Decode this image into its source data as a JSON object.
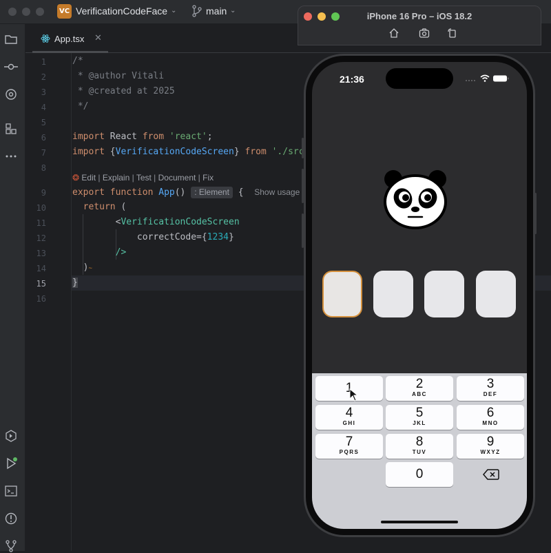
{
  "ide": {
    "project_badge": "VC",
    "project_name": "VerificationCodeFace",
    "branch": "main",
    "tab_label": "App.tsx",
    "line_numbers": [
      "1",
      "2",
      "3",
      "4",
      "5",
      "6",
      "7",
      "8",
      "9",
      "10",
      "11",
      "12",
      "13",
      "14",
      "15",
      "16"
    ],
    "code_lens": [
      "Edit",
      "Explain",
      "Test",
      "Document",
      "Fix"
    ],
    "code": {
      "l1": "/*",
      "l2": " * @author Vitali",
      "l3": " * @created at 2025",
      "l4": " */",
      "l6_kw1": "import",
      "l6_mid": " React ",
      "l6_kw2": "from",
      "l6_str": " 'react'",
      "l6_end": ";",
      "l7_kw1": "import",
      "l7_open": " {",
      "l7_comp": "VerificationCodeScreen",
      "l7_close": "} ",
      "l7_kw2": "from",
      "l7_str": " './src",
      "l9_kw1": "export",
      "l9_kw2": " function",
      "l9_fn": " App",
      "l9_paren": "()",
      "l9_hint": ": Element",
      "l9_brace": "{",
      "l9_usage": "Show usage",
      "l10_kw": "return",
      "l10_paren": " (",
      "l11_lt": "<",
      "l11_tag": "VerificationCodeScreen",
      "l12_attr": "correctCode=",
      "l12_open": "{",
      "l12_num": "1234",
      "l12_close": "}",
      "l13": "/>",
      "l14": ")",
      "l15": "}"
    }
  },
  "simulator": {
    "title": "iPhone 16 Pro – iOS 18.2",
    "time": "21:36",
    "code_boxes": 4,
    "active_box": 0,
    "keys": [
      {
        "d": "1",
        "l": ""
      },
      {
        "d": "2",
        "l": "ABC"
      },
      {
        "d": "3",
        "l": "DEF"
      },
      {
        "d": "4",
        "l": "GHI"
      },
      {
        "d": "5",
        "l": "JKL"
      },
      {
        "d": "6",
        "l": "MNO"
      },
      {
        "d": "7",
        "l": "PQRS"
      },
      {
        "d": "8",
        "l": "TUV"
      },
      {
        "d": "9",
        "l": "WXYZ"
      },
      {
        "d": "0",
        "l": ""
      }
    ]
  },
  "colors": {
    "accent_orange": "#d4903c",
    "ide_bg": "#1e1f22",
    "phone_screen": "#2c2c2e"
  }
}
